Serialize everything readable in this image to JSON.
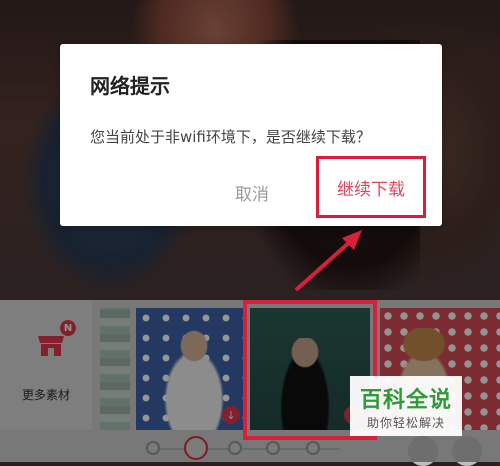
{
  "dialog": {
    "title": "网络提示",
    "message": "您当前处于非wifi环境下，是否继续下载？",
    "cancel_label": "取消",
    "continue_label": "继续下载"
  },
  "panel": {
    "more_label": "更多素材",
    "badge": "N"
  },
  "watermark": {
    "title": "百科全说",
    "subtitle": "助你轻松解决"
  },
  "colors": {
    "accent_red": "#d8203c",
    "watermark_green": "#2f9a3a"
  }
}
